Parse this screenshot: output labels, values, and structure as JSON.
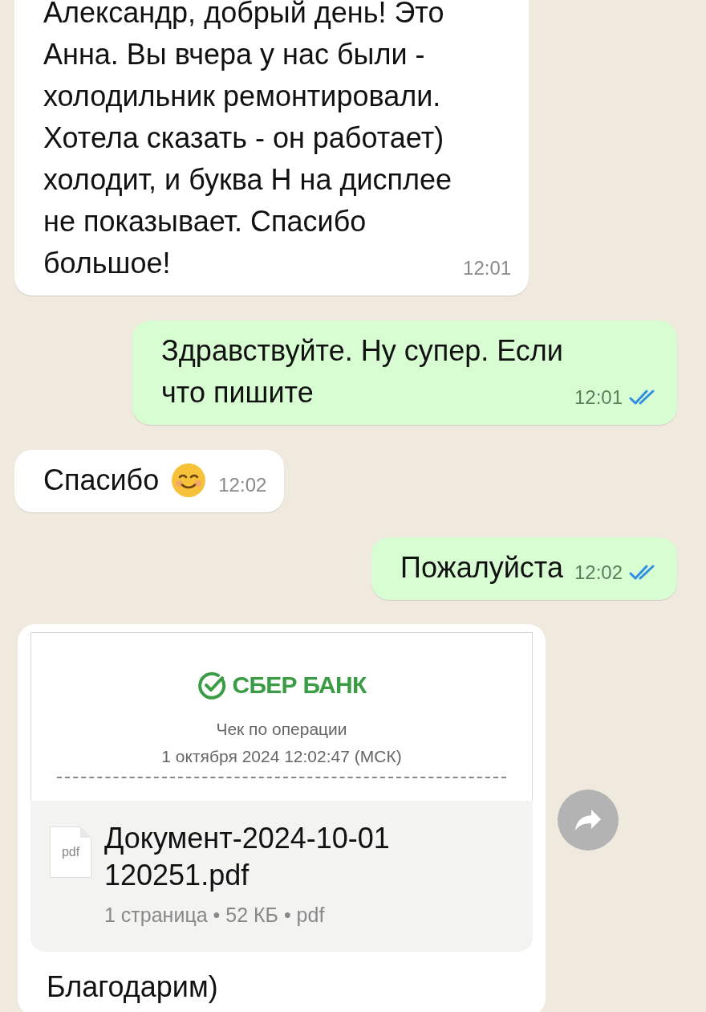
{
  "messages": [
    {
      "kind": "text",
      "outgoing": false,
      "text": "Александр, добрый день! Это\nАнна. Вы вчера у нас были -\nхолодильник ремонтировали.\nХотела сказать - он работает)\nхолодит, и буква Н на дисплее\nне показывает. Спасибо\nбольшое!",
      "time": "12:01"
    },
    {
      "kind": "text",
      "outgoing": true,
      "text": "Здравствуйте. Ну супер. Если\nчто пишите",
      "time": "12:01",
      "read": true
    },
    {
      "kind": "emoji_text",
      "outgoing": false,
      "text": "Спасибо",
      "time": "12:02"
    },
    {
      "kind": "text",
      "outgoing": true,
      "text": "Пожалуйста",
      "time": "12:02",
      "read": true
    },
    {
      "kind": "document",
      "preview": {
        "bank": "СБЕР БАНК",
        "title": "Чек по операции",
        "date": "1 октября 2024 12:02:47 (МСК)"
      },
      "file_type": "pdf",
      "file_name": "Документ-2024-10-01\n120251.pdf",
      "meta": "1 страница • 52 КБ • pdf",
      "caption": "Благодарим)"
    }
  ]
}
